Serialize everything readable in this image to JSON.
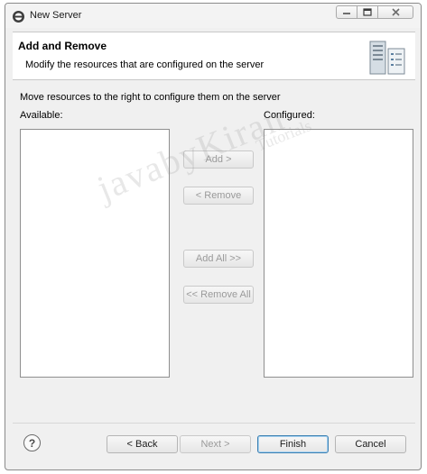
{
  "window": {
    "title": "New Server"
  },
  "header": {
    "title": "Add and Remove",
    "description": "Modify the resources that are configured on the server",
    "icon": "server-wizard-icon"
  },
  "main": {
    "instruction": "Move resources to the right to configure them on the server",
    "available_label": "Available:",
    "configured_label": "Configured:",
    "available_items": [],
    "configured_items": []
  },
  "actions": {
    "add": "Add >",
    "remove": "< Remove",
    "add_all": "Add All >>",
    "remove_all": "<< Remove All"
  },
  "footer": {
    "help": "?",
    "back": "< Back",
    "next": "Next >",
    "finish": "Finish",
    "cancel": "Cancel"
  },
  "watermark": {
    "main": "javabyKiran",
    "sub": "Tutorials"
  },
  "colors": {
    "dialog_bg": "#f0f0f0",
    "header_bg": "#ffffff",
    "default_button_border": "#3c7fb1",
    "disabled_text": "#9a9a9a"
  }
}
